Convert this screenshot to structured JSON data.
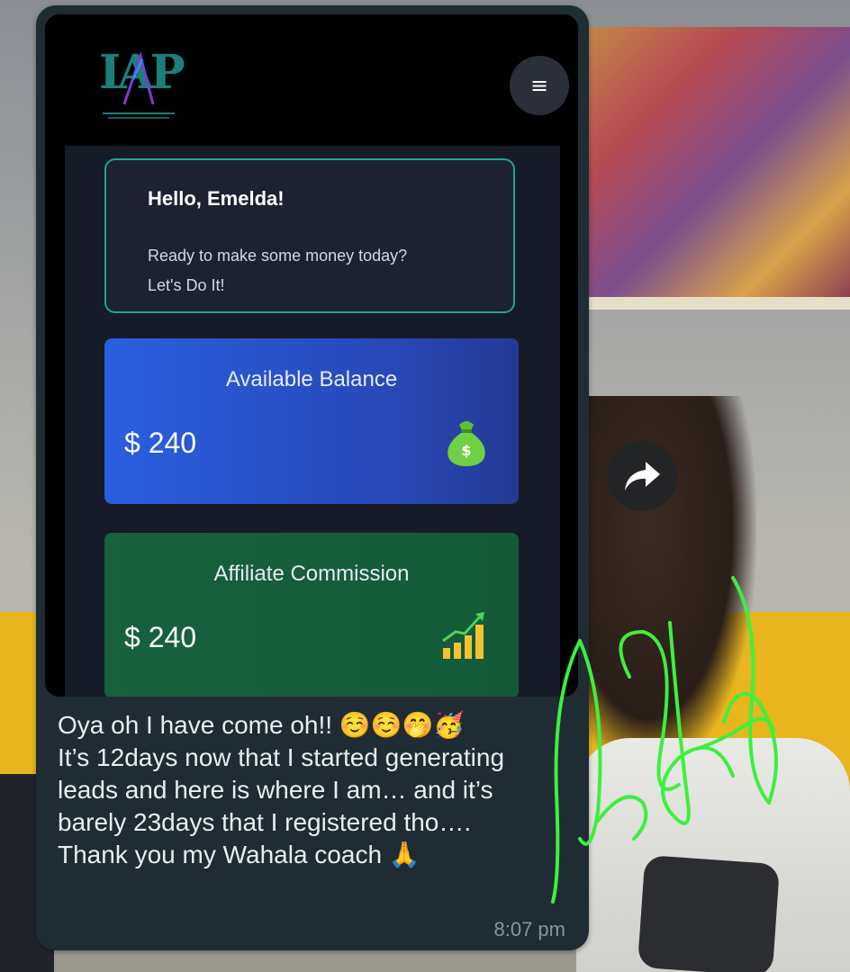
{
  "app": {
    "logo_text": "IAP",
    "menu_icon": "hamburger-icon"
  },
  "greeting": {
    "title": "Hello, Emelda!",
    "line1": "Ready to make some money today?",
    "line2": "Let's Do It!"
  },
  "cards": [
    {
      "title": "Available Balance",
      "value": "$ 240",
      "icon": "money-bag-icon",
      "color": "#2a5fe0"
    },
    {
      "title": "Affiliate Commission",
      "value": "$ 240",
      "icon": "growth-chart-icon",
      "color": "#17613d"
    }
  ],
  "message": {
    "lines": [
      "Oya oh I have come oh!! ☺️☺️🤭🥳",
      "It’s 12days now that I started generating",
      "leads and here is where I am… and it’s",
      "barely 23days that I registered tho….",
      "Thank you  my Wahala coach 🙏"
    ],
    "time": "8:07 pm"
  },
  "colors": {
    "bubble": "#1f2c34",
    "accent": "#1fa58e",
    "signature": "#3df03d"
  }
}
